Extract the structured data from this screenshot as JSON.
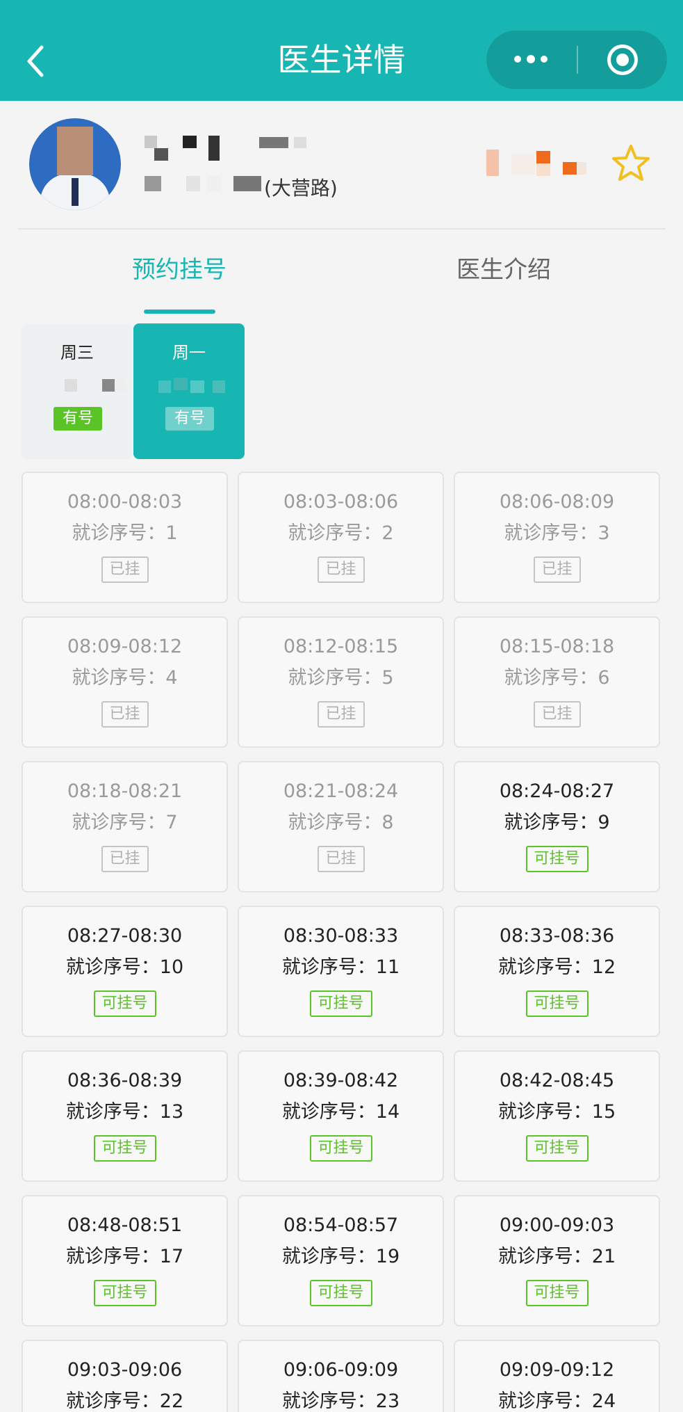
{
  "navbar": {
    "title": "医生详情",
    "icons": {
      "back": "chevron-left-icon",
      "more": "more-dots-icon",
      "close": "target-circle-icon"
    },
    "color": "#18b6b3"
  },
  "doctor": {
    "hospital_suffix": "(大营路)",
    "favorite_icon": "star-outline-icon",
    "star_color": "#f0c020"
  },
  "tabs": [
    {
      "label": "预约挂号",
      "active": true
    },
    {
      "label": "医生介绍",
      "active": false
    }
  ],
  "days": [
    {
      "weekday": "周三",
      "status": "有号",
      "selected": false
    },
    {
      "weekday": "周一",
      "status": "有号",
      "selected": true
    }
  ],
  "slots": [
    {
      "time": "08:00-08:03",
      "seq": "就诊序号：1",
      "status": "已挂",
      "available": false
    },
    {
      "time": "08:03-08:06",
      "seq": "就诊序号：2",
      "status": "已挂",
      "available": false
    },
    {
      "time": "08:06-08:09",
      "seq": "就诊序号：3",
      "status": "已挂",
      "available": false
    },
    {
      "time": "08:09-08:12",
      "seq": "就诊序号：4",
      "status": "已挂",
      "available": false
    },
    {
      "time": "08:12-08:15",
      "seq": "就诊序号：5",
      "status": "已挂",
      "available": false
    },
    {
      "time": "08:15-08:18",
      "seq": "就诊序号：6",
      "status": "已挂",
      "available": false
    },
    {
      "time": "08:18-08:21",
      "seq": "就诊序号：7",
      "status": "已挂",
      "available": false
    },
    {
      "time": "08:21-08:24",
      "seq": "就诊序号：8",
      "status": "已挂",
      "available": false
    },
    {
      "time": "08:24-08:27",
      "seq": "就诊序号：9",
      "status": "可挂号",
      "available": true
    },
    {
      "time": "08:27-08:30",
      "seq": "就诊序号：10",
      "status": "可挂号",
      "available": true
    },
    {
      "time": "08:30-08:33",
      "seq": "就诊序号：11",
      "status": "可挂号",
      "available": true
    },
    {
      "time": "08:33-08:36",
      "seq": "就诊序号：12",
      "status": "可挂号",
      "available": true
    },
    {
      "time": "08:36-08:39",
      "seq": "就诊序号：13",
      "status": "可挂号",
      "available": true
    },
    {
      "time": "08:39-08:42",
      "seq": "就诊序号：14",
      "status": "可挂号",
      "available": true
    },
    {
      "time": "08:42-08:45",
      "seq": "就诊序号：15",
      "status": "可挂号",
      "available": true
    },
    {
      "time": "08:48-08:51",
      "seq": "就诊序号：17",
      "status": "可挂号",
      "available": true
    },
    {
      "time": "08:54-08:57",
      "seq": "就诊序号：19",
      "status": "可挂号",
      "available": true
    },
    {
      "time": "09:00-09:03",
      "seq": "就诊序号：21",
      "status": "可挂号",
      "available": true
    },
    {
      "time": "09:03-09:06",
      "seq": "就诊序号：22",
      "status": "",
      "available": true
    },
    {
      "time": "09:06-09:09",
      "seq": "就诊序号：23",
      "status": "",
      "available": true
    },
    {
      "time": "09:09-09:12",
      "seq": "就诊序号：24",
      "status": "",
      "available": true
    }
  ],
  "colors": {
    "accent": "#18b6b3",
    "available_green": "#5ac325",
    "taken_gray": "#9a9a9a"
  }
}
